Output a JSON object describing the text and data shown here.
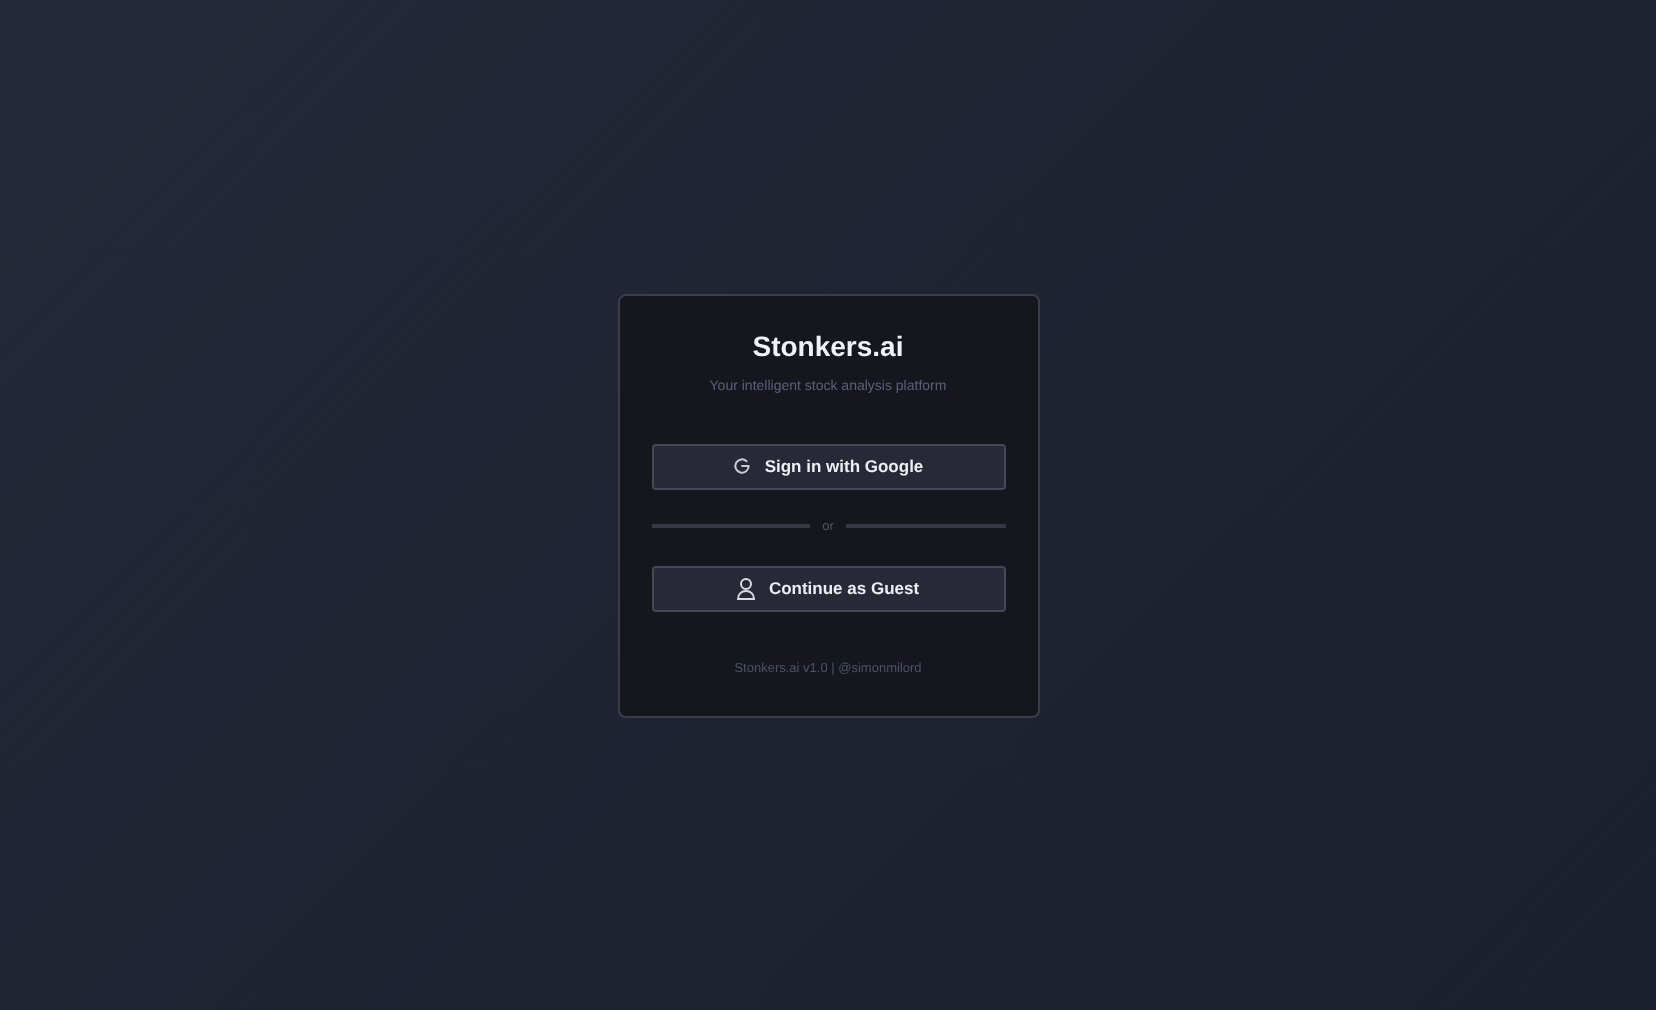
{
  "card": {
    "title": "Stonkers.ai",
    "subtitle": "Your intelligent stock analysis platform"
  },
  "buttons": [
    {
      "kind": "google",
      "label": "Sign in with Google"
    },
    {
      "kind": "guest",
      "label": "Continue as Guest"
    }
  ],
  "divider": {
    "label": "or"
  },
  "footer": "Stonkers.ai v1.0 | @simonmilord"
}
